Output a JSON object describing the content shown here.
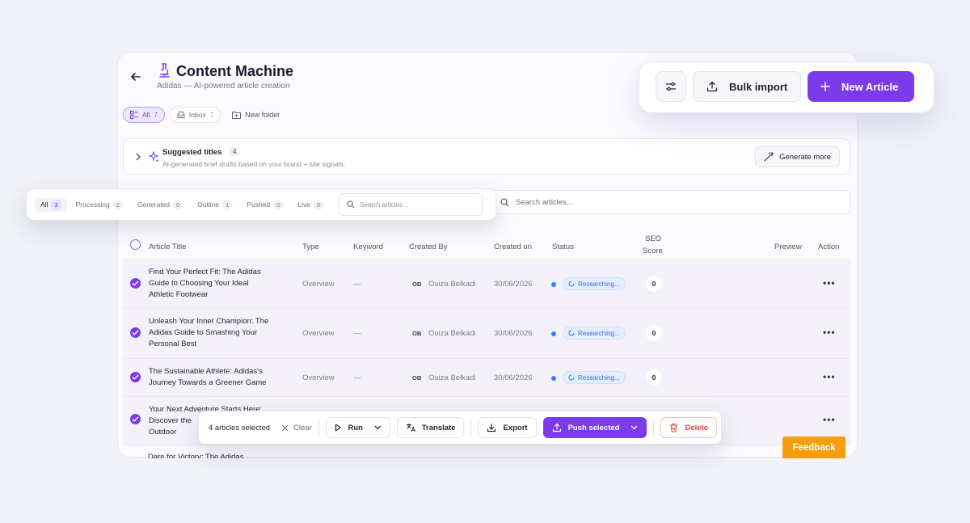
{
  "app": {
    "title": "Content Machine",
    "subtitle": "Adidas — AI-powered article creation"
  },
  "folders": [
    {
      "label": "All",
      "count": "7",
      "active": true
    },
    {
      "label": "Inbox",
      "count": "7",
      "active": false
    }
  ],
  "new_folder_label": "New folder",
  "suggested": {
    "title": "Suggested titles",
    "count": "4",
    "description": "AI-generated brief drafts based on your brand + site signals.",
    "generate_label": "Generate more"
  },
  "search": {
    "placeholder": "Search articles..."
  },
  "filters": [
    {
      "label": "All",
      "count": "3",
      "active": true
    },
    {
      "label": "Processing",
      "count": "2",
      "active": false
    },
    {
      "label": "Generated",
      "count": "0",
      "active": false
    },
    {
      "label": "Outline",
      "count": "1",
      "active": false
    },
    {
      "label": "Pushed",
      "count": "0",
      "active": false
    },
    {
      "label": "Live",
      "count": "0",
      "active": false
    }
  ],
  "filter_search": {
    "placeholder": "Search articles..."
  },
  "columns": {
    "title": "Article Title",
    "type": "Type",
    "keyword": "Keyword",
    "created_by": "Created By",
    "created_on": "Created on",
    "status": "Status",
    "seo_line1": "SEO",
    "seo_line2": "Score",
    "preview": "Preview",
    "action": "Action"
  },
  "rows": [
    {
      "title_lines": [
        "Find Your Perfect Fit: The Adidas",
        "Guide to Choosing Your Ideal",
        "Athletic Footwear"
      ],
      "type": "Overview",
      "keyword": "—",
      "initials": "OB",
      "author": "Ouiza Belkadi",
      "date": "30/06/2026",
      "status": "Researching...",
      "seo": "0",
      "more": "•••"
    },
    {
      "title_lines": [
        "Unleash Your Inner Champion: The",
        "Adidas Guide to Smashing Your",
        "Personal Best"
      ],
      "type": "Overview",
      "keyword": "—",
      "initials": "OB",
      "author": "Ouiza Belkadi",
      "date": "30/06/2026",
      "status": "Researching...",
      "seo": "0",
      "more": "•••"
    },
    {
      "title_lines": [
        "The Sustainable Athlete: Adidas's",
        "Journey Towards a Greener Game"
      ],
      "type": "Overview",
      "keyword": "—",
      "initials": "OB",
      "author": "Ouiza Belkadi",
      "date": "30/06/2026",
      "status": "Researching...",
      "seo": "0",
      "more": "•••"
    },
    {
      "title_lines": [
        "Your Next Adventure Starts Here:",
        "Discover the",
        "Outdoor"
      ],
      "more": "•••"
    }
  ],
  "peek_row_title": "Dare for Victory: The Adidas",
  "toolbar": {
    "bulk_import_label": "Bulk import",
    "new_article_label": "New Article"
  },
  "selection_bar": {
    "selected_label": "4 articles selected",
    "clear_label": "Clear",
    "run_label": "Run",
    "translate_label": "Translate",
    "export_label": "Export",
    "push_label": "Push selected",
    "delete_label": "Delete"
  },
  "feedback_label": "Feedback",
  "colors": {
    "accent": "#7c3aed",
    "status_blue": "#3b82f6",
    "feedback": "#f59e0b",
    "delete": "#e0443e"
  }
}
